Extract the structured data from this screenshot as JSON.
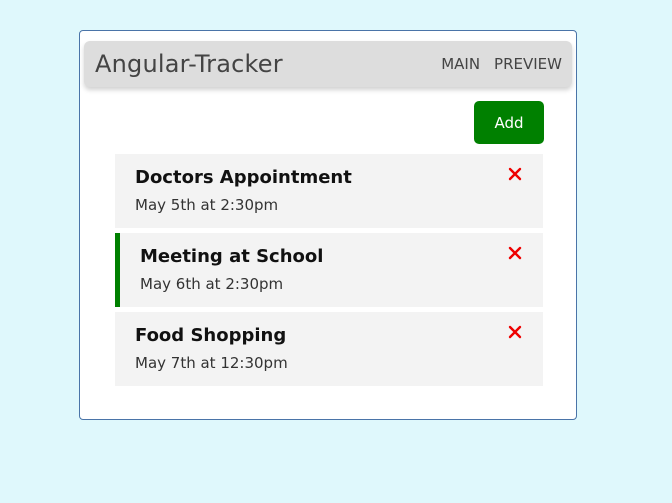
{
  "header": {
    "title": "Angular-Tracker",
    "nav": [
      "MAIN",
      "PREVIEW"
    ]
  },
  "add_button": {
    "label": "Add",
    "color": "#008000"
  },
  "tasks": [
    {
      "title": "Doctors Appointment",
      "date": "May 5th at 2:30pm",
      "reminder": false,
      "delete_icon": "close-icon"
    },
    {
      "title": "Meeting at School",
      "date": "May 6th at 2:30pm",
      "reminder": true,
      "delete_icon": "close-icon"
    },
    {
      "title": "Food Shopping",
      "date": "May 7th at 12:30pm",
      "reminder": false,
      "delete_icon": "close-icon"
    }
  ],
  "colors": {
    "background": "#dff8fc",
    "reminder_border": "#008000",
    "delete": "#ee0000"
  }
}
